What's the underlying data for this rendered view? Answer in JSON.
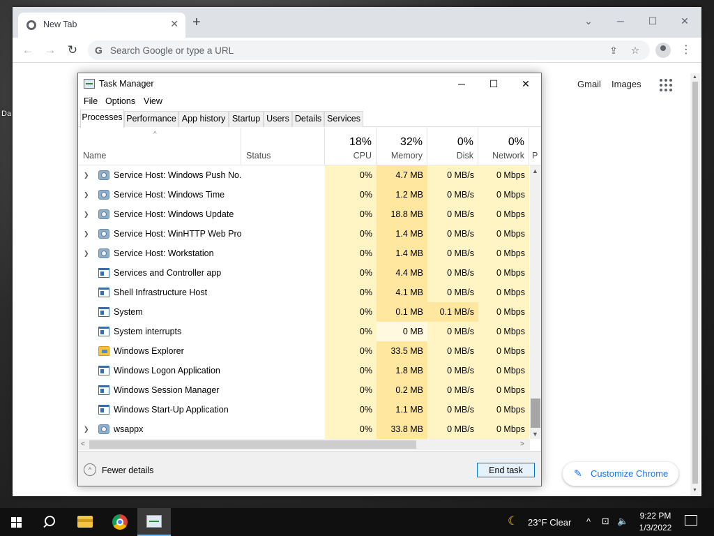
{
  "desktop": {
    "fragment_text": "Da"
  },
  "chrome": {
    "tab_title": "New Tab",
    "tab_close": "✕",
    "new_tab": "+",
    "controls": {
      "minimize": "─",
      "maximize": "☐",
      "close": "✕",
      "dropdown": "⌄"
    },
    "nav": {
      "back": "←",
      "forward": "→",
      "reload": "↻"
    },
    "omnibox_placeholder": "Search Google or type a URL",
    "omnibox_g": "G",
    "share": "⇪",
    "bookmark": "☆",
    "menu": "⋮",
    "ntp": {
      "gmail": "Gmail",
      "images": "Images",
      "customize": "Customize Chrome",
      "customize_icon": "✎"
    }
  },
  "taskmgr": {
    "title": "Task Manager",
    "controls": {
      "minimize": "─",
      "maximize": "☐",
      "close": "✕"
    },
    "menu": [
      "File",
      "Options",
      "View"
    ],
    "tabs": [
      "Processes",
      "Performance",
      "App history",
      "Startup",
      "Users",
      "Details",
      "Services"
    ],
    "active_tab": "Processes",
    "sort_caret": "^",
    "columns": {
      "name": "Name",
      "status": "Status",
      "cpu": {
        "pct": "18%",
        "label": "CPU"
      },
      "memory": {
        "pct": "32%",
        "label": "Memory"
      },
      "disk": {
        "pct": "0%",
        "label": "Disk"
      },
      "network": {
        "pct": "0%",
        "label": "Network"
      },
      "power": "P"
    },
    "rows": [
      {
        "name": "Service Host: Windows Push No...",
        "icon": "gear-icon",
        "expandable": true,
        "cpu": "0%",
        "memory": "4.7 MB",
        "disk": "0 MB/s",
        "network": "0 Mbps"
      },
      {
        "name": "Service Host: Windows Time",
        "icon": "gear-icon",
        "expandable": true,
        "cpu": "0%",
        "memory": "1.2 MB",
        "disk": "0 MB/s",
        "network": "0 Mbps"
      },
      {
        "name": "Service Host: Windows Update",
        "icon": "gear-icon",
        "expandable": true,
        "cpu": "0%",
        "memory": "18.8 MB",
        "disk": "0 MB/s",
        "network": "0 Mbps"
      },
      {
        "name": "Service Host: WinHTTP Web Pro...",
        "icon": "gear-icon",
        "expandable": true,
        "cpu": "0%",
        "memory": "1.4 MB",
        "disk": "0 MB/s",
        "network": "0 Mbps"
      },
      {
        "name": "Service Host: Workstation",
        "icon": "gear-icon",
        "expandable": true,
        "cpu": "0%",
        "memory": "1.4 MB",
        "disk": "0 MB/s",
        "network": "0 Mbps"
      },
      {
        "name": "Services and Controller app",
        "icon": "window-icon",
        "expandable": false,
        "cpu": "0%",
        "memory": "4.4 MB",
        "disk": "0 MB/s",
        "network": "0 Mbps"
      },
      {
        "name": "Shell Infrastructure Host",
        "icon": "window-icon",
        "expandable": false,
        "cpu": "0%",
        "memory": "4.1 MB",
        "disk": "0 MB/s",
        "network": "0 Mbps"
      },
      {
        "name": "System",
        "icon": "window-icon",
        "expandable": false,
        "cpu": "0%",
        "memory": "0.1 MB",
        "disk": "0.1 MB/s",
        "network": "0 Mbps"
      },
      {
        "name": "System interrupts",
        "icon": "window-icon",
        "expandable": false,
        "cpu": "0%",
        "memory": "0 MB",
        "disk": "0 MB/s",
        "network": "0 Mbps"
      },
      {
        "name": "Windows Explorer",
        "icon": "folder-icon",
        "expandable": false,
        "cpu": "0%",
        "memory": "33.5 MB",
        "disk": "0 MB/s",
        "network": "0 Mbps"
      },
      {
        "name": "Windows Logon Application",
        "icon": "window-icon",
        "expandable": false,
        "cpu": "0%",
        "memory": "1.8 MB",
        "disk": "0 MB/s",
        "network": "0 Mbps"
      },
      {
        "name": "Windows Session Manager",
        "icon": "window-icon",
        "expandable": false,
        "cpu": "0%",
        "memory": "0.2 MB",
        "disk": "0 MB/s",
        "network": "0 Mbps"
      },
      {
        "name": "Windows Start-Up Application",
        "icon": "window-icon",
        "expandable": false,
        "cpu": "0%",
        "memory": "1.1 MB",
        "disk": "0 MB/s",
        "network": "0 Mbps"
      },
      {
        "name": "wsappx",
        "icon": "gear-icon",
        "expandable": true,
        "cpu": "0%",
        "memory": "33.8 MB",
        "disk": "0 MB/s",
        "network": "0 Mbps"
      }
    ],
    "fewer_details": "Fewer details",
    "fewer_details_icon": "^",
    "end_task": "End task",
    "scroll": {
      "up": "▲",
      "down": "▼",
      "left": "<",
      "right": ">"
    }
  },
  "taskbar": {
    "weather_icon": "☾",
    "weather": "23°F  Clear",
    "tray_chevron": "^",
    "tray_network": "⊡",
    "tray_volume": "🔈",
    "time": "9:22 PM",
    "date": "1/3/2022"
  },
  "colors": {
    "accent": "#0078d7",
    "cpu_mem_highlight": "#ffe79f",
    "light_highlight": "#fff4c4",
    "chrome_blue": "#1a73e8"
  }
}
